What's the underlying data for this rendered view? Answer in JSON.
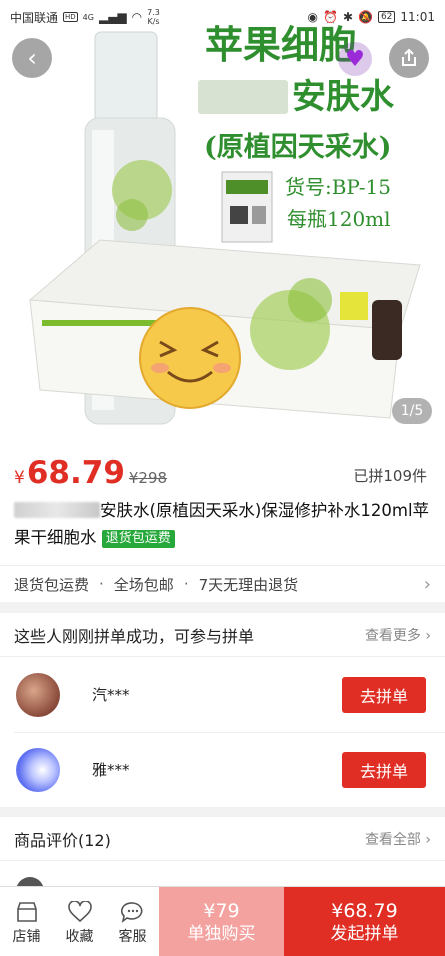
{
  "status_bar": {
    "carrier": "中国联通",
    "network_badge": "HD",
    "signal_label": "4G",
    "speed_value": "7.3",
    "speed_unit": "K/s",
    "battery": "62",
    "time": "11:01"
  },
  "hero": {
    "line1": "苹果细胞",
    "line2": "安肤水",
    "line3": "(原植因天采水)",
    "item_no": "货号:BP-15",
    "volume": "每瓶120ml",
    "pager": "1/5"
  },
  "product": {
    "currency": "¥",
    "price": "68.79",
    "old_price": "¥298",
    "sold": "已拼109件",
    "title": "安肤水(原植因天采水)保湿修护补水120ml苹果干细胞水",
    "title_tag": "退货包运费",
    "services": [
      "退货包运费",
      "全场包邮",
      "7天无理由退货"
    ],
    "service_sep": "·"
  },
  "group": {
    "heading": "这些人刚刚拼单成功，可参与拼单",
    "more": "查看更多",
    "members": [
      {
        "name": "汽***",
        "button": "去拼单"
      },
      {
        "name": "雅***",
        "button": "去拼单"
      }
    ]
  },
  "reviews": {
    "heading": "商品评价(12)",
    "more": "查看全部"
  },
  "bottom_bar": {
    "store": "店铺",
    "favorite": "收藏",
    "service": "客服",
    "alone_price": "¥79",
    "alone_label": "单独购买",
    "group_price": "¥68.79",
    "group_label": "发起拼单"
  },
  "colors": {
    "accent": "#e02e24",
    "accent_light": "#f4a2a0",
    "tag_green": "#27a83a",
    "hero_text_green": "#2f8f2f"
  }
}
